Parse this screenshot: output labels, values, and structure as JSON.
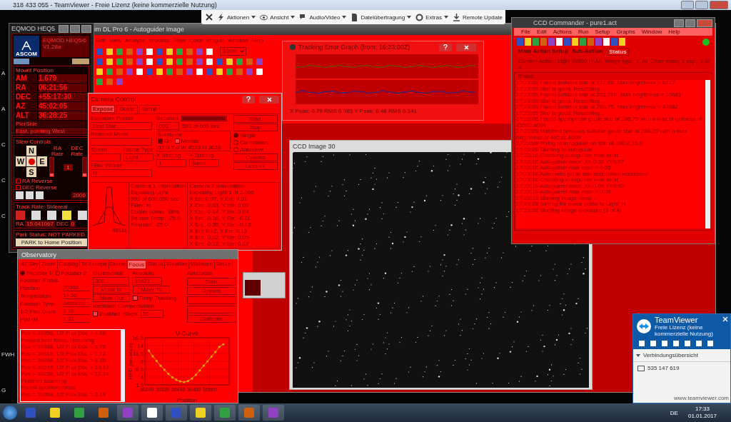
{
  "remote_window": {
    "title": "318 433 055 - TeamViewer - Freie Lizenz (keine kommerzielle Nutzung)"
  },
  "remote_toolbar": {
    "items": [
      {
        "label": "Aktionen",
        "dropdown": true
      },
      {
        "label": "Ansicht",
        "dropdown": true
      },
      {
        "label": "Audio/Video",
        "dropdown": true
      },
      {
        "label": "Dateiübertragung",
        "dropdown": true
      },
      {
        "label": "Extras",
        "dropdown": true
      },
      {
        "label": "Remote Update",
        "dropdown": false
      }
    ]
  },
  "desktop_labels": [
    "A",
    "A",
    "C",
    "C",
    "C",
    "FWH",
    "G"
  ],
  "maxim": {
    "title": "im DL Pro 6 - Autoguider Image",
    "menu": [
      "Edit",
      "View",
      "Analyze",
      "Process",
      "Filter",
      "Color",
      "Plug-in",
      "Window",
      "Help"
    ],
    "zoom": "100%"
  },
  "eqmod": {
    "title": "EQMOD HEQ5",
    "name": "EQMOD HEQ5/6",
    "version": "V1.28a",
    "logo": "ASCOM",
    "mount_title": "Mount Position",
    "positions": [
      {
        "label": "AM",
        "value": "1.679"
      },
      {
        "label": "RA",
        "value": "06:21:56"
      },
      {
        "label": "DEC",
        "value": "+55:17:30"
      },
      {
        "label": "AZ",
        "value": "45:02:05"
      },
      {
        "label": "ALT",
        "value": "36:28:25"
      }
    ],
    "pierside_label": "PierSide",
    "pierside": "East, pointing West",
    "slew_title": "Slew Controls",
    "directions": [
      "N",
      "W",
      "E",
      "S"
    ],
    "ra_rate": "RA Rate",
    "dec_rate": "DEC Rate",
    "rate_value": "1",
    "rate_sliders": [
      {
        "level": 0.15
      },
      {
        "level": 0.15
      }
    ],
    "reverse": [
      {
        "label": "RA Reverse",
        "checked": false
      },
      {
        "label": "DEC Reverse",
        "checked": false
      }
    ],
    "speed": "2000",
    "track_title": "Track Rate: Sidereal",
    "ra_label": "RA",
    "ra_rate_value": "15.041067",
    "dec_label": "DEC",
    "dec_rate_value": "0",
    "park_title": "Park Status: NOT PARKED",
    "park_button": "PARK to Home Position"
  },
  "tracking_graph": {
    "title": "Tracking Error Graph (from: 16:23:00Z)",
    "footer": "X Peak: 0.79   RMS 0.083   Y Peak: 0.48   RMS 0.141"
  },
  "camera_control": {
    "title": "Camera Control",
    "tabs": [
      {
        "label": "Expose",
        "selected": true
      },
      {
        "label": "Guide",
        "selected": false
      },
      {
        "label": "Setup",
        "selected": false
      }
    ],
    "preset_label": "Exposure Preset",
    "preset": "First Star",
    "seconds_label": "Seconds",
    "seconds": "600",
    "progress_text": "593 of 600 sec",
    "level": 0.99,
    "readout_label": "Readout Mode",
    "speed_label": "Speed",
    "frame_label": "Frame Type",
    "frame": "Light",
    "filter_label": "Filter Wheel",
    "filter": "H",
    "subframe_label": "Subframe",
    "subframe_on": {
      "label": "On",
      "checked": true
    },
    "mosaic": {
      "label": "Mosaic",
      "checked": false
    },
    "subframe_info": "0X  0 Y  0 W 4528 H 3628",
    "xbin_label": "X Binning",
    "xbin": "1",
    "ybin_label": "Y Binning",
    "ybin": "Same",
    "buttons": [
      "Start",
      "Stop",
      "Options",
      "Less <<"
    ],
    "modes": [
      {
        "label": "Single",
        "selected": true
      },
      {
        "label": "Continuous",
        "selected": false
      },
      {
        "label": "Autosave",
        "selected": false
      }
    ],
    "profile_value": "40111",
    "camera1": [
      "Camera 1 Information",
      "Exposing Light",
      "593 of 600.000 sec",
      "Filter: H",
      "Cooler power: 38%",
      "Sensor Temp: -25.0",
      "Setpoint: -25.0"
    ],
    "camera2": [
      "Camera 2 Information",
      "Exposing Light 1 of 2.000",
      "X Err: 0.07, Y Err: 0.01",
      "X Err: -0.03, Y Err: 0.00",
      "X Err: -0.14, Y Err: 0.04",
      "X Err: -0.16, Y Err: -0.11",
      "X Err: -0.35, Y Err: -0.13",
      "X Err: 0.12, Y Err: 0.13",
      "X Err: -0.12, Y Err: 0.05",
      "X Err: -0.12, Y Err: 0.17"
    ]
  },
  "ccd_image": {
    "title": "CCD Image 30"
  },
  "ccd_commander": {
    "title": "CCD Commander - pure1.act",
    "menu": [
      "File",
      "Edit",
      "Actions",
      "Run",
      "Setup",
      "Graphs",
      "Window",
      "Help"
    ],
    "tabs": [
      {
        "label": "Main Action Setup",
        "selected": false
      },
      {
        "label": "Sub-Action",
        "selected": false
      },
      {
        "label": "Status",
        "selected": true
      }
    ],
    "current_action": "Current Action: Light 4x600 H-Alf, Image type: 1, All Other every 1 exp.: 1 of 4",
    "status_label": "Status",
    "log": [
      "17:23:05  Found suitable star at 172,80.  Max brightness = 6217",
      "17:23:05  Star is good.  Recording...",
      "17:23:05  Found suitable star at 261,210.  Max brightness = 20681",
      "17:23:05  Star is good.  Recording...",
      "17:23:05  Found suitable star at 286,75.  Max brightness = 43582",
      "17:23:05  Star is good.  Recording...",
      "17:23:05  Found appropriate guide star at 286,75 with a max brightness of 43582.4001",
      "17:23:05  Matched previous suitable guide star at 286,75 with a max brightness of 43582.4000",
      "17:23:09  Trying to autoguide on star at 286.0,75.0",
      "17:23:09  Starting to autoguide",
      "17:23:16  Checking autoguider max error...",
      "17:23:16  Autoguider error: X=-0.35 Y=0.07",
      "17:23:16  Autoguider max error = 0.35",
      "17:23:16  Automatic guide star acquisition successful",
      "17:23:16  Checking autoguider max error...",
      "17:23:19  Autoguider error: X=-0.09 Y=0.02",
      "17:23:19  Autoguider max error = 0.09",
      "17:23:19  Starting image delay...",
      "17:23:28  Setting file name prefix to Light_H",
      "17:23:28  Starting image exposure (1 of 4)"
    ]
  },
  "observatory": {
    "title": "Observatory",
    "tabs": [
      {
        "label": "All Sky",
        "selected": false
      },
      {
        "label": "Zoom",
        "selected": false
      },
      {
        "label": "Catalog",
        "selected": false
      },
      {
        "label": "Telescope",
        "selected": false
      },
      {
        "label": "Dome",
        "selected": false
      },
      {
        "label": "Focus",
        "selected": true
      },
      {
        "label": "Status",
        "selected": false
      },
      {
        "label": "Weather",
        "selected": false
      },
      {
        "label": "Webcam",
        "selected": false
      },
      {
        "label": "Setup",
        "selected": false
      }
    ],
    "focusers": [
      {
        "label": "Focuser 1",
        "selected": true
      },
      {
        "label": "Focuser 2",
        "selected": false
      }
    ],
    "status_title": "Focuser Status",
    "fields": [
      {
        "label": "Position",
        "value": "30398"
      },
      {
        "label": "Temperature",
        "value": "14.50"
      },
      {
        "label": "Focuser Type",
        "value": "Absolute"
      },
      {
        "label": "1/2 Flux Diam.",
        "value": "3.19"
      },
      {
        "label": "FWHM",
        "value": "2.32"
      }
    ],
    "incremental_title": "Incremental",
    "incremental": "300",
    "absolute_title": "Absolute",
    "absolute": "30421",
    "autofocus_title": "Autofocus",
    "move_in": "Move In",
    "move_out": "Move Out",
    "move_to": "Move To",
    "temp_tracking": {
      "label": "Temp Tracking",
      "checked": false
    },
    "backlash_title": "Backlash Compensation",
    "backlash_enabled": {
      "label": "Enabled",
      "checked": false
    },
    "steps_label": "Steps",
    "steps": "50",
    "autofocus_buttons": [
      {
        "kind": "button",
        "label": "Start"
      },
      {
        "kind": "button",
        "label": "Options"
      },
      {
        "kind": "blank"
      },
      {
        "kind": "blank"
      },
      {
        "kind": "button",
        "label": "Calibrate"
      }
    ],
    "log": [
      "Pos = 30358, 1/2 Flux Dia. = 4.66",
      "Passed best focus, resuming",
      "Pos = 30338, 1/2 Flux Dia. = 5.75",
      "Pos = 30318, 1/2 Flux Dia. = 7.12",
      "Pos = 30298, 1/2 Flux Dia. = 8.36",
      "Pos = 30278, 1/2 Flux Dia. = 10.13",
      "Pos = 30258, 1/2 Flux Dia. = 12.19",
      "Finished scanning",
      "Found optimum focus",
      "Pos = 30398, 1/2 Flux Dia. = 3.19"
    ],
    "chart_data": {
      "type": "line",
      "title": "V-Curve",
      "xlabel": "Position",
      "ylabel": "HFD (arcsecs)",
      "x": [
        30250,
        30270,
        30290,
        30310,
        30330,
        30350,
        30370,
        30390,
        30410,
        30430,
        30450,
        30470,
        30490,
        30510,
        30530,
        30550,
        30570,
        30590,
        30610,
        30630
      ],
      "series": [
        {
          "color": "#e0a000",
          "values": [
            12.4,
            10.6,
            9.1,
            7.6,
            6.3,
            5.0,
            3.9,
            3.1,
            2.6,
            2.4,
            2.7,
            3.5,
            4.7,
            6.1,
            7.6,
            9.0,
            10.5,
            12.0,
            13.6,
            14.4
          ]
        }
      ],
      "xlim": [
        30230,
        30660
      ],
      "ylim": [
        1.5,
        16.5
      ],
      "xticks": [
        30240,
        30320,
        30400,
        30480,
        30560
      ],
      "yticks": [
        1.5,
        4,
        6.5,
        9,
        11.5,
        14,
        16.5
      ],
      "grid": true
    }
  },
  "teamviewer_popup": {
    "brand": "TeamViewer",
    "notice": "Freie Lizenz (keine kommerzielle Nutzung)",
    "section": "Verbindungsübersicht",
    "session": "535 147 619",
    "link": "www.teamviewer.com"
  },
  "taskbar": {
    "language": "DE",
    "time": "17:33",
    "date": "01.01.2017"
  }
}
